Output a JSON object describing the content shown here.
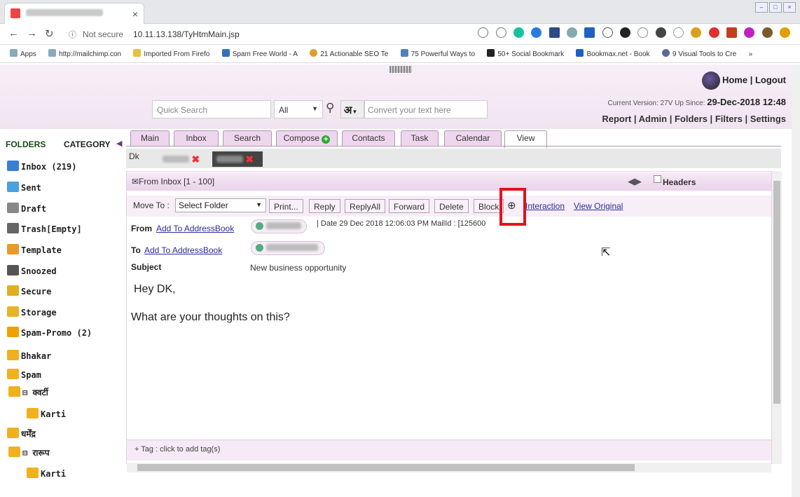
{
  "browser": {
    "tab_close": "×",
    "url_security": "Not secure",
    "url": "10.11.13.138/TyHtmMain.jsp",
    "bookmarks": [
      "Apps",
      "http://mailchimp.con",
      "Imported From Firefo",
      "Spam Free World - A",
      "21 Actionable SEO Te",
      "75 Powerful Ways to",
      "50+ Social Bookmark",
      "Bookmax.net - Book",
      "9 Visual Tools to Cre"
    ],
    "more_bookmarks": "»"
  },
  "header": {
    "quick_search_placeholder": "Quick Search",
    "scope_select": "All",
    "hindi_label": "अ",
    "convert_placeholder": "Convert your text here",
    "home": "Home",
    "logout": "Logout",
    "version_text": "Current Version: 27V Up Since:",
    "version_date": "29-Dec-2018 12:48",
    "menu": [
      "Report",
      "Admin",
      "Folders",
      "Filters",
      "Settings"
    ]
  },
  "sidebar": {
    "folders_label": "FOLDERS",
    "category_label": "CATEGORY",
    "items": [
      {
        "label": "Inbox (219)",
        "icon": "inbox-icon",
        "color": "#3a7fd4"
      },
      {
        "label": "Sent",
        "icon": "sent-icon",
        "color": "#4aa0e0"
      },
      {
        "label": "Draft",
        "icon": "draft-icon",
        "color": "#888888"
      },
      {
        "label": "Trash[Empty]",
        "icon": "trash-icon",
        "color": "#666666"
      },
      {
        "label": "Template",
        "icon": "template-icon",
        "color": "#e89a2a"
      },
      {
        "label": "Snoozed",
        "icon": "snooze-icon",
        "color": "#555555"
      },
      {
        "label": "Secure",
        "icon": "lock-icon",
        "color": "#e0b020"
      },
      {
        "label": "Storage",
        "icon": "storage-icon",
        "color": "#e6b428"
      },
      {
        "label": "Spam-Promo (2)",
        "icon": "spam-icon",
        "color": "#f0a000"
      },
      {
        "label": "Bhakar",
        "icon": "folder-icon",
        "color": "#f0b020"
      },
      {
        "label": "Spam",
        "icon": "folder-icon",
        "color": "#f0b020"
      },
      {
        "label": "⊟ क्वर्टी",
        "icon": "folder-icon",
        "color": "#f0b020"
      },
      {
        "label": "Karti",
        "icon": "folder-icon",
        "color": "#f0b020"
      },
      {
        "label": "धर्मेंद्र",
        "icon": "folder-icon",
        "color": "#f0b020"
      },
      {
        "label": "⊟ रारूप",
        "icon": "folder-icon",
        "color": "#f0b020"
      },
      {
        "label": "Karti",
        "icon": "folder-icon",
        "color": "#f0b020"
      }
    ]
  },
  "tabs": [
    "Main",
    "Inbox",
    "Search",
    "Compose",
    "Contacts",
    "Task",
    "Calendar",
    "View"
  ],
  "subtabs": {
    "first": "Dk"
  },
  "message": {
    "from_bar": "From  Inbox [1 - 100]",
    "headers_label": "Headers",
    "move_to_label": "Move To :",
    "folder_select": "Select Folder",
    "actions": [
      "Print...",
      "Reply",
      "ReplyAll",
      "Forward",
      "Delete",
      "Block"
    ],
    "interaction": "Interaction",
    "view_original": "View Original",
    "from_label": "From",
    "to_label": "To",
    "add_to_addressbook": "Add To AddressBook",
    "date_text": "|  Date 29 Dec 2018 12:06:03 PM   MailId : [125600",
    "subject_label": "Subject",
    "subject": "New business opportunity",
    "body_greeting": "Hey DK,",
    "body_text": "What are your thoughts on this?",
    "tag_text": "+ Tag : click to add tag(s)"
  }
}
